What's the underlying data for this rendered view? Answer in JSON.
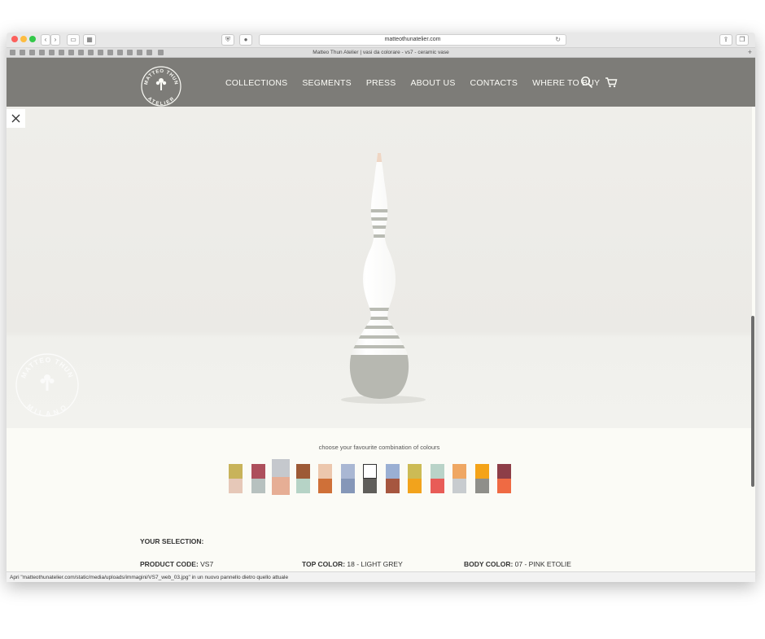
{
  "browser": {
    "url": "matteothunatelier.com",
    "tab_title": "Matteo Thun Atelier | vasi da colorare - vs7 - ceramic vase",
    "status": "Apri \"matteothunatelier.com/static/media/uploads/immagini/VS7_web_03.jpg\" in un nuovo pannello dietro quello attuale"
  },
  "header": {
    "logo_top": "MATTEO THUN",
    "logo_bottom": "ATELIER",
    "nav": [
      "COLLECTIONS",
      "SEGMENTS",
      "PRESS",
      "ABOUT US",
      "CONTACTS",
      "WHERE TO BUY"
    ]
  },
  "watermark": {
    "top": "MATTEO THUN",
    "bottom": "MILANO"
  },
  "selector": {
    "prompt": "choose your favourite combination of colours",
    "swatches": [
      {
        "top": "#c8b35a",
        "bottom": "#e6c8b8"
      },
      {
        "top": "#ad4f5c",
        "bottom": "#b7c1bf"
      },
      {
        "top": "#c5c8cd",
        "bottom": "#e6ae95",
        "selected": true
      },
      {
        "top": "#9d5a36",
        "bottom": "#b6d3c6"
      },
      {
        "top": "#ecc7ad",
        "bottom": "#cf7038"
      },
      {
        "top": "#a9b7d3",
        "bottom": "#8597b8"
      },
      {
        "top": "#ffffff",
        "bottom": "#5f5e5a"
      },
      {
        "top": "#9aafd3",
        "bottom": "#a6563f"
      },
      {
        "top": "#ccbb55",
        "bottom": "#f2a31c"
      },
      {
        "top": "#b9d3c8",
        "bottom": "#e85c57"
      },
      {
        "top": "#efa763",
        "bottom": "#c8cccf"
      },
      {
        "top": "#f4a318",
        "bottom": "#8f8f8a"
      },
      {
        "top": "#8d3e48",
        "bottom": "#ef6a43"
      }
    ]
  },
  "selection": {
    "title": "YOUR SELECTION:",
    "product_label": "PRODUCT CODE:",
    "product_value": " VS7",
    "top_label": "TOP COLOR:",
    "top_value": " 18 - LIGHT GREY",
    "body_label": "BODY COLOR:",
    "body_value": " 07 - PINK ETOLIE"
  }
}
